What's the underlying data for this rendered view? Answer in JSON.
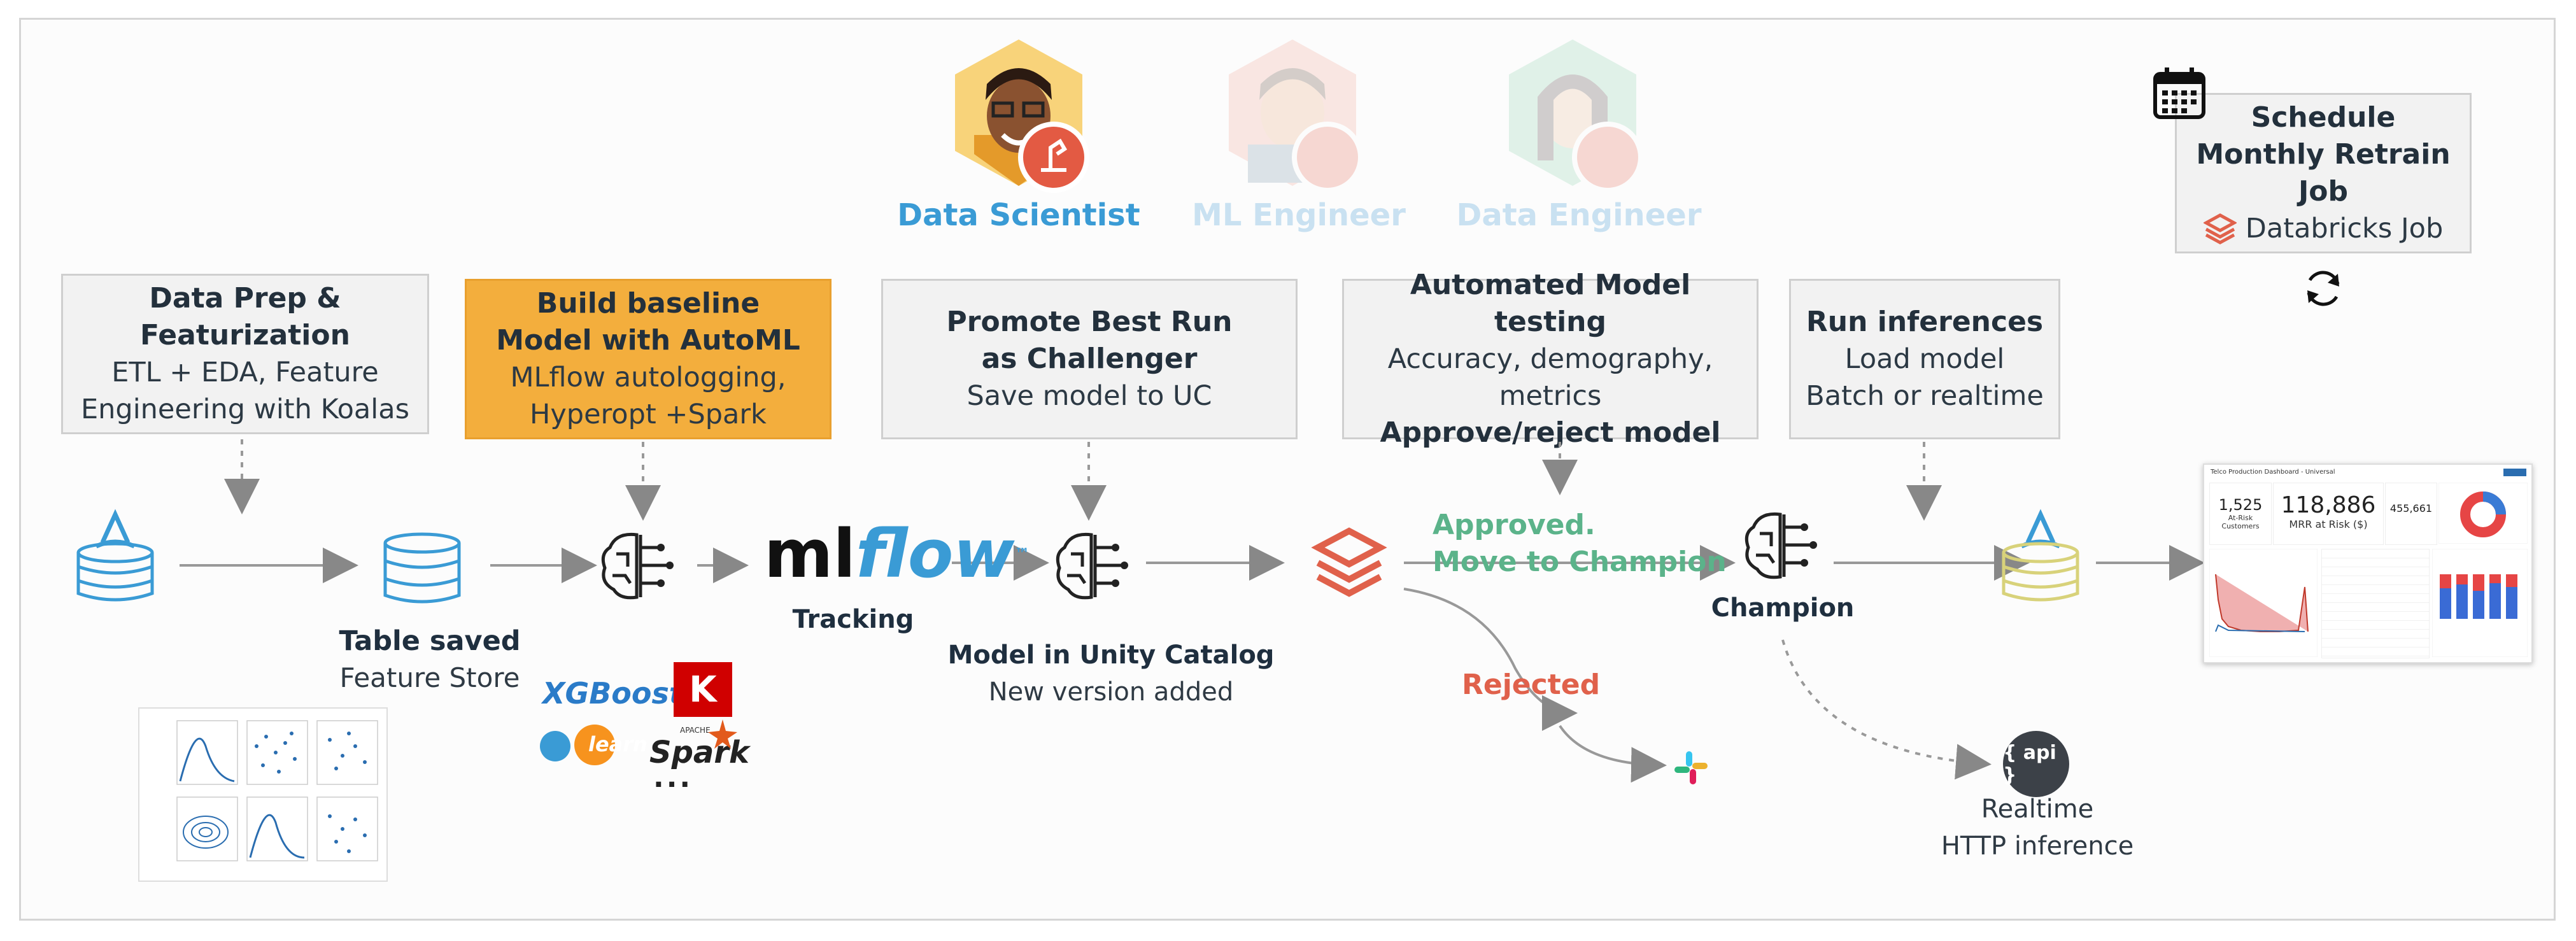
{
  "personas": [
    {
      "label": "Data Scientist",
      "color": "#3a9bd5"
    },
    {
      "label": "ML Engineer",
      "color": "#b9d9ee"
    },
    {
      "label": "Data Engineer",
      "color": "#b9d9ee"
    }
  ],
  "steps": {
    "data_prep": {
      "title": "Data Prep & Featurization",
      "body": "ETL + EDA, Feature Engineering with Koalas"
    },
    "baseline": {
      "title": "Build baseline Model with AutoML",
      "body": "MLflow autologging, Hyperopt +Spark"
    },
    "promote": {
      "title": "Promote Best Run as Challenger",
      "body": "Save model to UC"
    },
    "testing": {
      "title": "Automated Model testing",
      "body": "Accuracy, demography, metrics",
      "footer": "Approve/reject model"
    },
    "inference": {
      "title": "Run inferences",
      "line1": "Load model",
      "line2": "Batch or realtime"
    },
    "schedule": {
      "title": "Schedule Monthly Retrain Job",
      "body": "Databricks Job"
    }
  },
  "nodes": {
    "table_saved": {
      "title": "Table saved",
      "sub": "Feature Store"
    },
    "mlflow": {
      "logo_ml": "ml",
      "logo_flow": "flow",
      "tm": "™",
      "caption": "Tracking"
    },
    "unity_catalog": {
      "title": "Model in Unity Catalog",
      "sub": "New version added"
    },
    "approved": {
      "line1": "Approved.",
      "line2": "Move to Champion"
    },
    "rejected": "Rejected",
    "champion": "Champion",
    "api": {
      "badge": "{ api }",
      "line1": "Realtime",
      "line2": "HTTP inference"
    }
  },
  "libraries": {
    "xgboost": "XGBoost",
    "keras": "K",
    "sklearn": "learn",
    "spark": "Spark",
    "spark_small": "APACHE",
    "more": "..."
  },
  "dashboard": {
    "header": "Telco Production Dashboard - Universal",
    "kpi1_value": "1,525",
    "kpi1_label": "At-Risk Customers",
    "kpi2_value": "118,886",
    "kpi2_label": "MRR at Risk ($)",
    "kpi3_value": "455,661"
  },
  "colors": {
    "accent_blue": "#3a9bd5",
    "orange": "#f3ae3d",
    "green": "#5bb38a",
    "red": "#e0614b",
    "gray_box": "#f2f2f2"
  },
  "icons": [
    "delta-table-icon",
    "database-icon",
    "brain-icon",
    "databricks-icon",
    "slack-icon",
    "calendar-icon",
    "refresh-icon"
  ]
}
